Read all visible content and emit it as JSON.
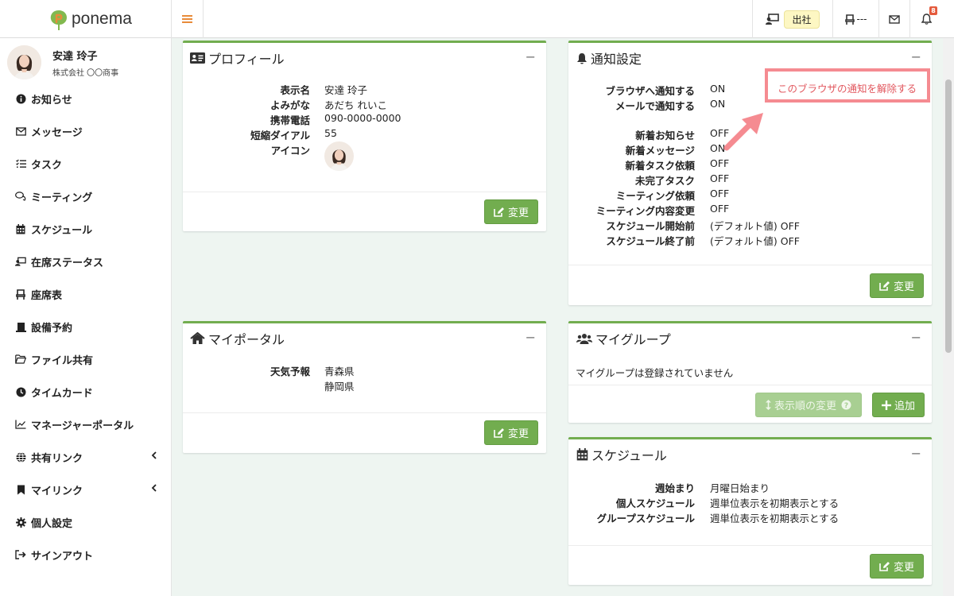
{
  "app": {
    "brand": "ponema"
  },
  "header": {
    "attendance_status": "出社",
    "seat_text": "---",
    "notification_count": "8"
  },
  "sidebar": {
    "user": {
      "name": "安達 玲子",
      "company": "株式会社 〇〇商事"
    },
    "items": [
      {
        "label": "お知らせ",
        "icon": "info-icon"
      },
      {
        "label": "メッセージ",
        "icon": "mail-icon"
      },
      {
        "label": "タスク",
        "icon": "list-check-icon"
      },
      {
        "label": "ミーティング",
        "icon": "chat-icon"
      },
      {
        "label": "スケジュール",
        "icon": "calendar-icon"
      },
      {
        "label": "在席ステータス",
        "icon": "presence-icon"
      },
      {
        "label": "座席表",
        "icon": "seat-icon"
      },
      {
        "label": "設備予約",
        "icon": "equipment-icon"
      },
      {
        "label": "ファイル共有",
        "icon": "folder-icon"
      },
      {
        "label": "タイムカード",
        "icon": "clock-icon"
      },
      {
        "label": "マネージャーポータル",
        "icon": "chart-icon"
      },
      {
        "label": "共有リンク",
        "icon": "globe-icon"
      },
      {
        "label": "マイリンク",
        "icon": "bookmark-icon"
      },
      {
        "label": "個人設定",
        "icon": "gear-icon"
      },
      {
        "label": "サインアウト",
        "icon": "signout-icon"
      }
    ]
  },
  "profile": {
    "title": "プロフィール",
    "rows": [
      {
        "label": "表示名",
        "value": "安達 玲子"
      },
      {
        "label": "よみがな",
        "value": "あだち れいこ"
      },
      {
        "label": "携帯電話",
        "value": "090-0000-0000"
      },
      {
        "label": "短縮ダイアル",
        "value": "55"
      },
      {
        "label": "アイコン",
        "value": ""
      }
    ],
    "button": "変更"
  },
  "portal": {
    "title": "マイポータル",
    "label": "天気予報",
    "values": [
      "青森県",
      "静岡県"
    ],
    "button": "変更"
  },
  "notify": {
    "title": "通知設定",
    "top_rows": [
      {
        "label": "ブラウザへ通知する",
        "value": "ON"
      },
      {
        "label": "メールで通知する",
        "value": "ON"
      }
    ],
    "rows": [
      {
        "label": "新着お知らせ",
        "value": "OFF"
      },
      {
        "label": "新着メッセージ",
        "value": "ON"
      },
      {
        "label": "新着タスク依頼",
        "value": "OFF"
      },
      {
        "label": "未完了タスク",
        "value": "OFF"
      },
      {
        "label": "ミーティング依頼",
        "value": "OFF"
      },
      {
        "label": "ミーティング内容変更",
        "value": "OFF"
      },
      {
        "label": "スケジュール開始前",
        "value": "(デフォルト値) OFF"
      },
      {
        "label": "スケジュール終了前",
        "value": "(デフォルト値) OFF"
      }
    ],
    "unsubscribe_link": "このブラウザの通知を解除する",
    "button": "変更"
  },
  "groups": {
    "title": "マイグループ",
    "empty_text": "マイグループは登録されていません",
    "sort_button": "表示順の変更",
    "add_button": "追加"
  },
  "schedule": {
    "title": "スケジュール",
    "rows": [
      {
        "label": "週始まり",
        "value": "月曜日始まり"
      },
      {
        "label": "個人スケジュール",
        "value": "週単位表示を初期表示とする"
      },
      {
        "label": "グループスケジュール",
        "value": "週単位表示を初期表示とする"
      }
    ],
    "button": "変更"
  },
  "colors": {
    "accent": "#72ad4f",
    "brand_orange": "#e88b3a",
    "highlight": "#f58b91"
  }
}
